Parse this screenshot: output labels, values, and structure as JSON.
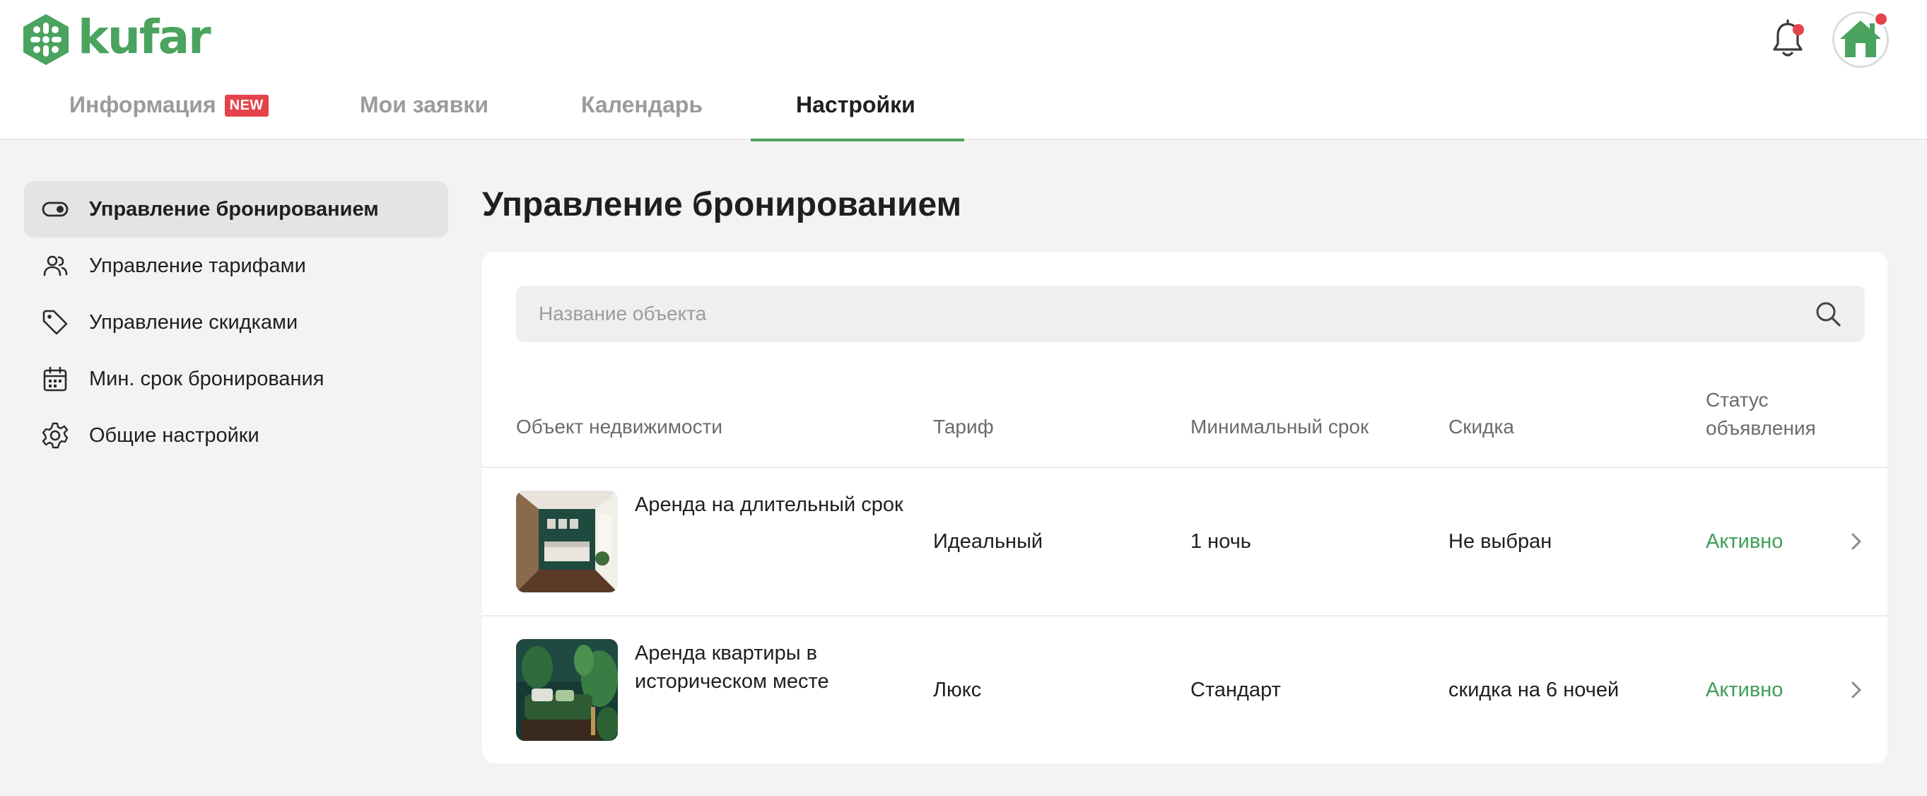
{
  "header": {
    "logo_text": "kufar",
    "brand_color": "#4aa35e",
    "icons": {
      "bell": "bell-icon",
      "avatar": "house-avatar-icon"
    }
  },
  "tabs": [
    {
      "label": "Информация",
      "badge": "NEW",
      "active": false
    },
    {
      "label": "Мои заявки",
      "active": false
    },
    {
      "label": "Календарь",
      "active": false
    },
    {
      "label": "Настройки",
      "active": true
    }
  ],
  "sidebar": {
    "items": [
      {
        "label": "Управление бронированием",
        "icon": "toggle-icon",
        "active": true
      },
      {
        "label": "Управление тарифами",
        "icon": "users-icon",
        "active": false
      },
      {
        "label": "Управление скидками",
        "icon": "tag-icon",
        "active": false
      },
      {
        "label": "Мин. срок бронирования",
        "icon": "calendar-icon",
        "active": false
      },
      {
        "label": "Общие настройки",
        "icon": "gear-icon",
        "active": false
      }
    ]
  },
  "main": {
    "title": "Управление бронированием",
    "search": {
      "placeholder": "Название объекта",
      "value": ""
    },
    "table": {
      "columns": {
        "object": "Объект недвижимости",
        "tariff": "Тариф",
        "min_term": "Минимальный срок",
        "discount": "Скидка",
        "status_line1": "Статус",
        "status_line2": "объявления"
      },
      "rows": [
        {
          "name": "Аренда на длительный срок",
          "tariff": "Идеальный",
          "min_term": "1 ночь",
          "discount": "Не выбран",
          "status": "Активно"
        },
        {
          "name": "Аренда квартиры в историческом месте",
          "tariff": "Люкс",
          "min_term": "Стандарт",
          "discount": "скидка на 6 ночей",
          "status": "Активно"
        }
      ]
    }
  },
  "colors": {
    "accent": "#4aa35e",
    "status_active": "#3f9e55",
    "badge": "#e5434b",
    "background": "#f3f3f3"
  }
}
